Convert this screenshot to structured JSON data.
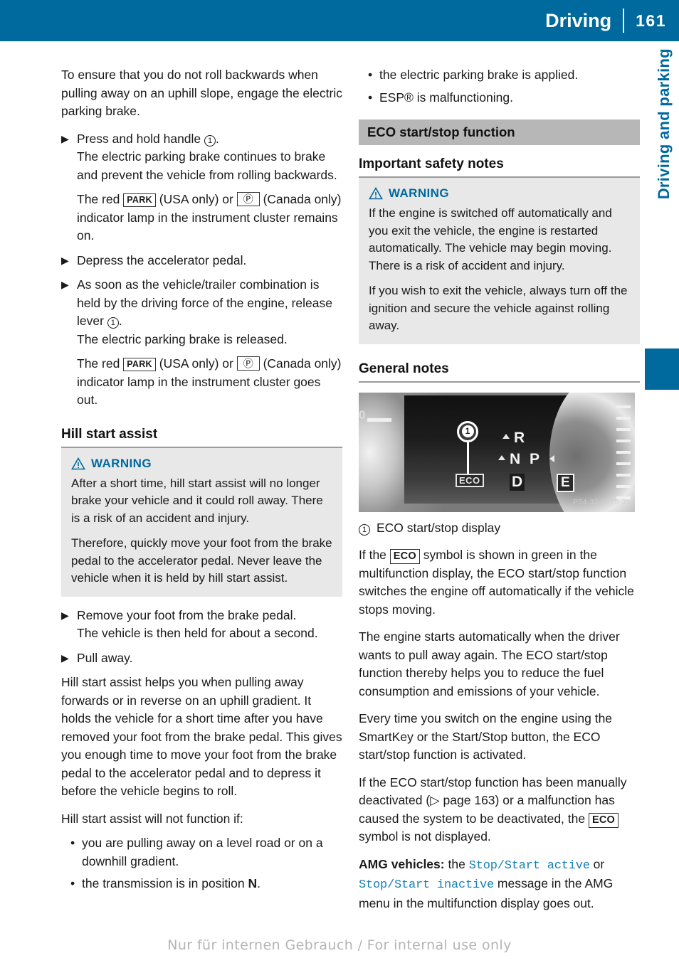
{
  "header": {
    "title": "Driving",
    "page_number": "161"
  },
  "side_tab": {
    "label": "Driving and parking"
  },
  "left_column": {
    "intro": "To ensure that you do not roll backwards when pulling away on an uphill slope, engage the electric parking brake.",
    "step1": {
      "marker": "▶",
      "text_before": "Press and hold handle",
      "ref": "1",
      "text_after": ".",
      "result1": "The electric parking brake continues to brake and prevent the vehicle from rolling backwards.",
      "result2_a": "The red",
      "sym_park": "PARK",
      "result2_b": "(USA only) or",
      "sym_pbrake": "Ⓟ",
      "result2_c": "(Canada only) indicator lamp in the instrument cluster remains on."
    },
    "step2": {
      "marker": "▶",
      "text": "Depress the accelerator pedal."
    },
    "step3": {
      "marker": "▶",
      "text_before": "As soon as the vehicle/trailer combination is held by the driving force of the engine, release lever",
      "ref": "1",
      "text_after": ".",
      "result1": "The electric parking brake is released.",
      "result2_a": "The red",
      "sym_park": "PARK",
      "result2_b": "(USA only) or",
      "sym_pbrake": "Ⓟ",
      "result2_c": "(Canada only) indicator lamp in the instrument cluster goes out."
    },
    "hill_start_heading": "Hill start assist",
    "warning": {
      "title": "WARNING",
      "icon": "warning-triangle-icon",
      "paragraphs": [
        "After a short time, hill start assist will no longer brake your vehicle and it could roll away. There is a risk of an accident and injury.",
        "Therefore, quickly move your foot from the brake pedal to the accelerator pedal. Never leave the vehicle when it is held by hill start assist."
      ]
    },
    "step4": {
      "marker": "▶",
      "text": "Remove your foot from the brake pedal.",
      "result": "The vehicle is then held for about a second."
    },
    "step5": {
      "marker": "▶",
      "text": "Pull away."
    },
    "body1": "Hill start assist helps you when pulling away forwards or in reverse on an uphill gradient. It holds the vehicle for a short time after you have removed your foot from the brake pedal. This gives you enough time to move your foot from the brake pedal to the accelerator pedal and to depress it before the vehicle begins to roll.",
    "body2": "Hill start assist will not function if:",
    "bullets_a": "you are pulling away on a level road or on a downhill gradient.",
    "bullets_b_before": "the transmission is in position",
    "bullets_b_bold": "N",
    "bullets_b_after": "."
  },
  "right_column": {
    "bullets_top": [
      "the electric parking brake is applied.",
      "ESP® is malfunctioning."
    ],
    "section_heading": "ECO start/stop function",
    "sub_heading_1": "Important safety notes",
    "warning": {
      "title": "WARNING",
      "icon": "warning-triangle-icon",
      "paragraphs": [
        "If the engine is switched off automatically and you exit the vehicle, the engine is restarted automatically. The vehicle may begin moving. There is a risk of accident and injury.",
        "If you wish to exit the vehicle, always turn off the ignition and secure the vehicle against rolling away."
      ]
    },
    "sub_heading_2": "General notes",
    "figure": {
      "eco_chip": "ECO",
      "gear_r": "R",
      "gear_n": "N",
      "gear_p": "P",
      "gear_d": "D",
      "gear_e": "E",
      "callout_number": "1",
      "image_code": "P54.32-9675-31",
      "left_digit": "0"
    },
    "legend": {
      "ref": "1",
      "text": "ECO start/stop display"
    },
    "para1_a": "If the",
    "para1_sym": "ECO",
    "para1_b": "symbol is shown in green in the multifunction display, the ECO start/stop function switches the engine off automatically if the vehicle stops moving.",
    "para2": "The engine starts automatically when the driver wants to pull away again. The ECO start/stop function thereby helps you to reduce the fuel consumption and emissions of your vehicle.",
    "para3": "Every time you switch on the engine using the SmartKey or the Start/Stop button, the ECO start/stop function is activated.",
    "para4_a": "If the ECO start/stop function has been manually deactivated (",
    "para4_arrow": "▷",
    "para4_b": "page 163) or a malfunction has caused the system to be deactivated, the",
    "para4_sym": "ECO",
    "para4_c": "symbol is not displayed.",
    "para5_bold": "AMG vehicles:",
    "para5_a": "the",
    "para5_mono1": "Stop/Start active",
    "para5_b": "or",
    "para5_mono2": "Stop/Start inactive",
    "para5_c": "message in the AMG menu in the multifunction display goes out."
  },
  "footer": {
    "watermark": "Nur für internen Gebrauch / For internal use only"
  },
  "colors": {
    "header_blue": "#00699d",
    "band_gray": "#b7b7b7",
    "warn_bg": "#e8e8e8",
    "mono_blue": "#1680b4"
  }
}
